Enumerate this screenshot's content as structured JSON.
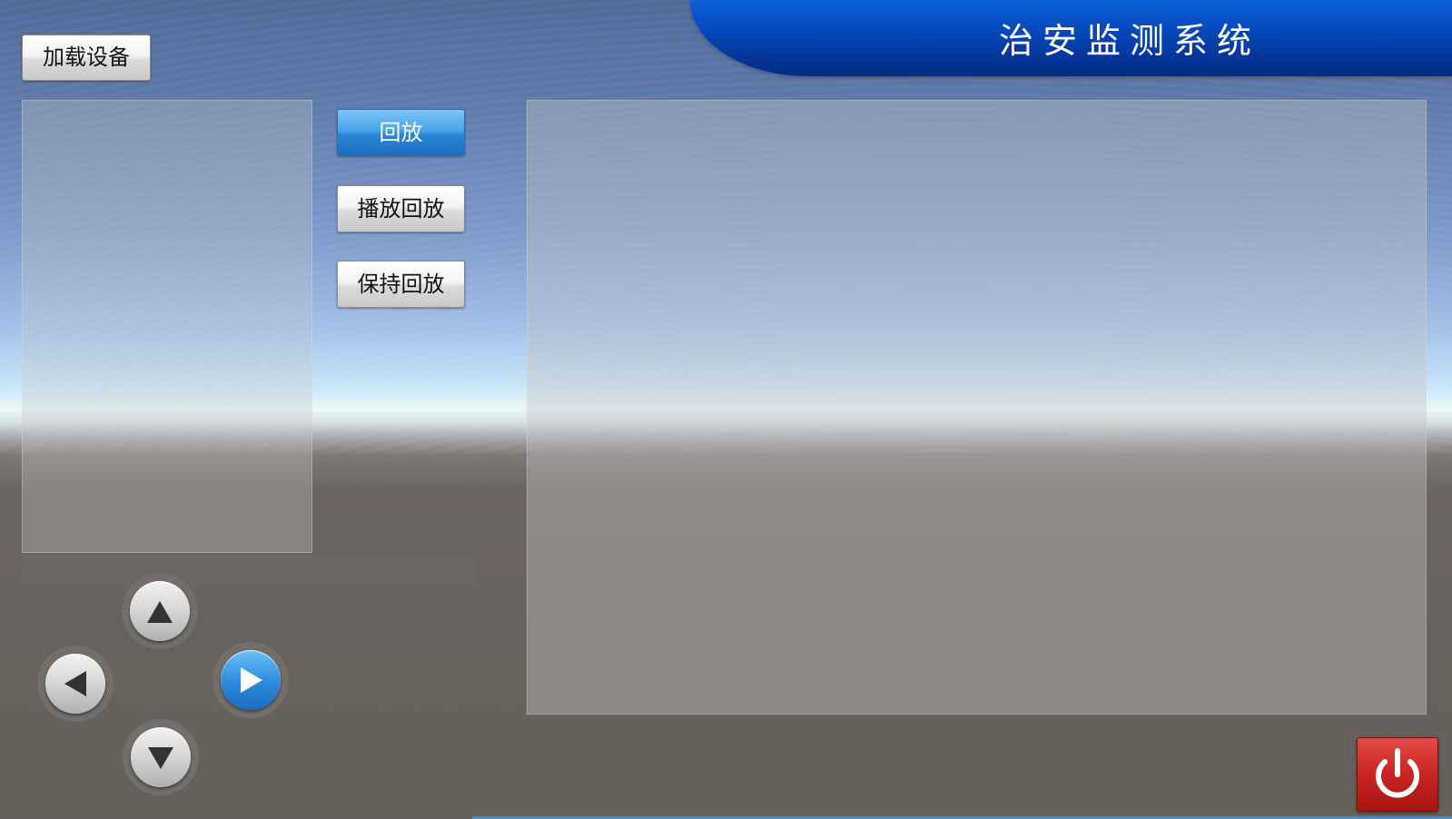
{
  "header": {
    "title": "治安监测系统"
  },
  "toolbar": {
    "load_device_label": "加载设备"
  },
  "playback_controls": {
    "replay_label": "回放",
    "play_replay_label": "播放回放",
    "hold_replay_label": "保持回放",
    "active": "回放"
  },
  "dpad": {
    "up_icon": "triangle-up-icon",
    "down_icon": "triangle-down-icon",
    "left_icon": "triangle-left-icon",
    "right_icon": "triangle-right-icon",
    "active_direction": "right"
  },
  "power": {
    "icon": "power-icon",
    "color": "#c92422"
  },
  "colors": {
    "banner": "#064cbf",
    "active_button": "#2a86d6"
  }
}
